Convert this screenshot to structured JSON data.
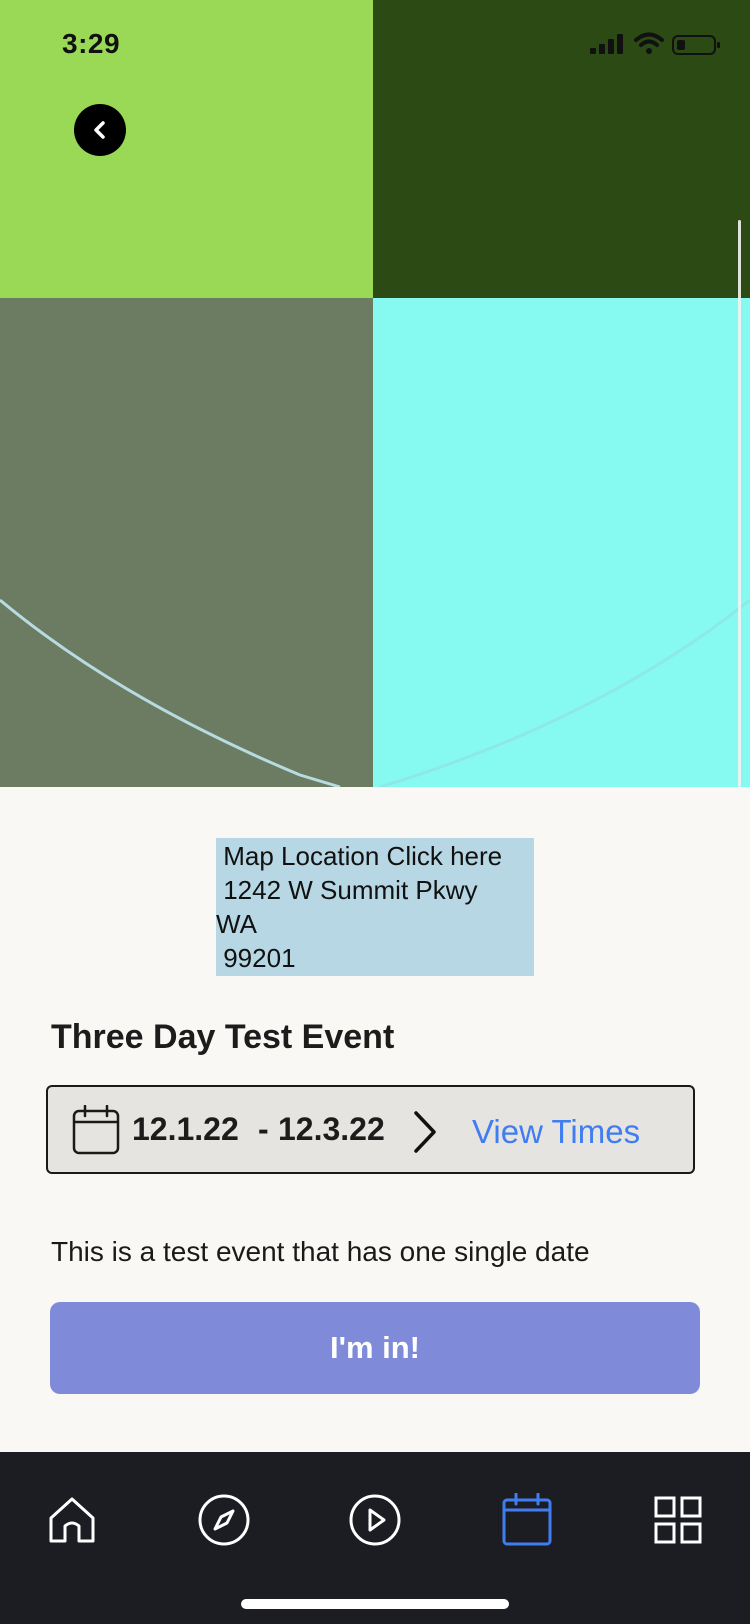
{
  "status_bar": {
    "time": "3:29"
  },
  "map_location": {
    "lines": [
      " Map Location Click here",
      " 1242 W Summit Pkwy",
      "WA",
      " 99201"
    ]
  },
  "event": {
    "title": "Three Day Test Event",
    "start_date": "12.1.22",
    "separator": "-",
    "end_date": "12.3.22",
    "view_times_label": "View Times",
    "description": "This is a test event that has one single date",
    "cta_label": "I'm in!"
  },
  "tab_bar": {
    "items": [
      {
        "icon": "home-icon",
        "active": false
      },
      {
        "icon": "compass-icon",
        "active": false
      },
      {
        "icon": "play-icon",
        "active": false
      },
      {
        "icon": "calendar-icon",
        "active": true
      },
      {
        "icon": "grid-icon",
        "active": false
      }
    ]
  },
  "colors": {
    "accent": "#3f7df0",
    "cta": "#7f8bd9",
    "tab_active": "#3f7df0",
    "tab_inactive": "#ffffff",
    "tabbar_bg": "#1c1d22",
    "page_bg": "#faf8f4"
  }
}
